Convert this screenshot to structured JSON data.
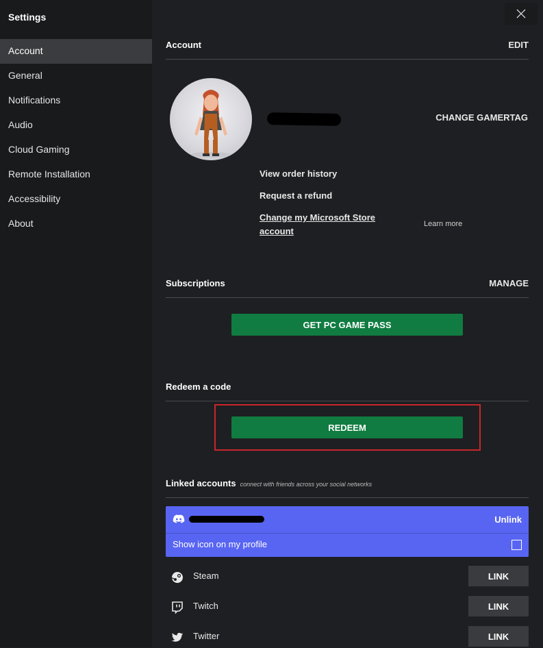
{
  "sidebar": {
    "title": "Settings",
    "items": [
      {
        "label": "Account"
      },
      {
        "label": "General"
      },
      {
        "label": "Notifications"
      },
      {
        "label": "Audio"
      },
      {
        "label": "Cloud Gaming"
      },
      {
        "label": "Remote Installation"
      },
      {
        "label": "Accessibility"
      },
      {
        "label": "About"
      }
    ]
  },
  "icons": {
    "close": "close-icon",
    "discord": "discord-icon",
    "steam": "steam-icon",
    "twitch": "twitch-icon",
    "twitter": "twitter-icon"
  },
  "colors": {
    "accent_green": "#107c41",
    "discord_blurple": "#5865f2",
    "highlight_red": "#c8262b"
  },
  "account": {
    "title": "Account",
    "edit_label": "EDIT",
    "change_gamertag_label": "CHANGE GAMERTAG",
    "view_order_history": "View order history",
    "request_refund": "Request a refund",
    "change_store_line1": "Change my Microsoft Store",
    "change_store_line2": "account",
    "learn_more": "Learn more"
  },
  "subscriptions": {
    "title": "Subscriptions",
    "manage_label": "MANAGE",
    "game_pass_button": "GET PC GAME PASS"
  },
  "redeem": {
    "title": "Redeem a code",
    "button": "REDEEM"
  },
  "linked_accounts": {
    "title": "Linked accounts",
    "subtitle": "connect with friends across your social networks",
    "discord": {
      "unlink_label": "Unlink",
      "show_icon_label": "Show icon on my profile"
    },
    "services": [
      {
        "name": "Steam",
        "button": "LINK"
      },
      {
        "name": "Twitch",
        "button": "LINK"
      },
      {
        "name": "Twitter",
        "button": "LINK"
      }
    ]
  }
}
